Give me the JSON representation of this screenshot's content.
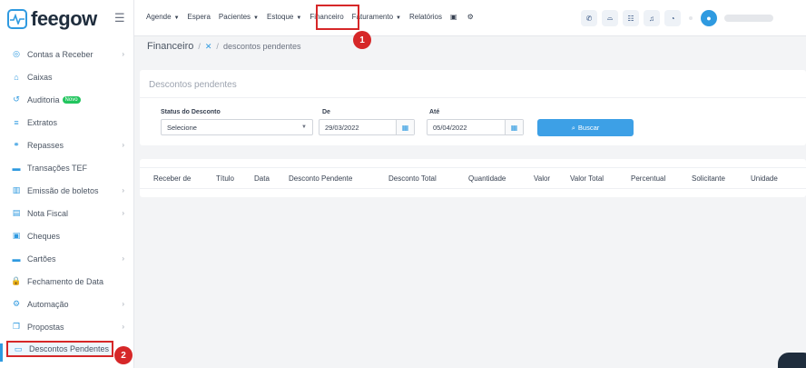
{
  "app": {
    "logo_text": "feegow"
  },
  "sidebar": {
    "items": [
      {
        "label": "Contas a Receber",
        "icon": "coin-icon",
        "glyph": "◎",
        "chevron": true
      },
      {
        "label": "Caixas",
        "icon": "cash-register-icon",
        "glyph": "⌂",
        "chevron": false
      },
      {
        "label": "Auditoria",
        "icon": "history-icon",
        "glyph": "↺",
        "chevron": false,
        "badge": "Novo"
      },
      {
        "label": "Extratos",
        "icon": "list-icon",
        "glyph": "≡",
        "chevron": false
      },
      {
        "label": "Repasses",
        "icon": "handshake-icon",
        "glyph": "⚭",
        "chevron": true
      },
      {
        "label": "Transações TEF",
        "icon": "card-icon",
        "glyph": "▬",
        "chevron": false
      },
      {
        "label": "Emissão de boletos",
        "icon": "barcode-icon",
        "glyph": "▥",
        "chevron": true
      },
      {
        "label": "Nota Fiscal",
        "icon": "file-icon",
        "glyph": "▤",
        "chevron": true
      },
      {
        "label": "Cheques",
        "icon": "check-icon",
        "glyph": "▣",
        "chevron": false
      },
      {
        "label": "Cartões",
        "icon": "credit-card-icon",
        "glyph": "▬",
        "chevron": true
      },
      {
        "label": "Fechamento de Data",
        "icon": "lock-icon",
        "glyph": "🔒",
        "chevron": false
      },
      {
        "label": "Automação",
        "icon": "cogs-icon",
        "glyph": "⚙",
        "chevron": true
      },
      {
        "label": "Propostas",
        "icon": "copy-icon",
        "glyph": "❐",
        "chevron": true
      }
    ],
    "active_item": {
      "label": "Descontos Pendentes",
      "icon": "money-icon",
      "glyph": "▭"
    }
  },
  "topbar": {
    "menu": [
      {
        "label": "Agende",
        "caret": true
      },
      {
        "label": "Espera",
        "caret": false
      },
      {
        "label": "Pacientes",
        "caret": true
      },
      {
        "label": "Estoque",
        "caret": true
      },
      {
        "label": "Financeiro",
        "caret": false
      },
      {
        "label": "Faturamento",
        "caret": true
      },
      {
        "label": "Relatórios",
        "caret": false
      }
    ],
    "menu_icons": [
      "save-icon",
      "gear-icon"
    ],
    "right_icons": [
      "phone-icon",
      "inbox-icon",
      "list-icon",
      "bell-icon",
      "chat-icon"
    ]
  },
  "steps": {
    "one": "1",
    "two": "2"
  },
  "breadcrumb": {
    "title": "Financeiro",
    "separator": "/",
    "current": "descontos pendentes"
  },
  "filter": {
    "title": "Descontos pendentes",
    "status_label": "Status do Desconto",
    "status_value": "Selecione",
    "from_label": "De",
    "from_value": "29/03/2022",
    "to_label": "Até",
    "to_value": "05/04/2022",
    "search_label": "Buscar"
  },
  "table": {
    "columns": [
      "Receber de",
      "Título",
      "Data",
      "Desconto Pendente",
      "Desconto Total",
      "Quantidade",
      "Valor",
      "Valor Total",
      "Percentual",
      "Solicitante",
      "Unidade"
    ]
  },
  "colors": {
    "accent": "#2f9ae0",
    "marker": "#d62728",
    "button": "#3da0e6"
  }
}
